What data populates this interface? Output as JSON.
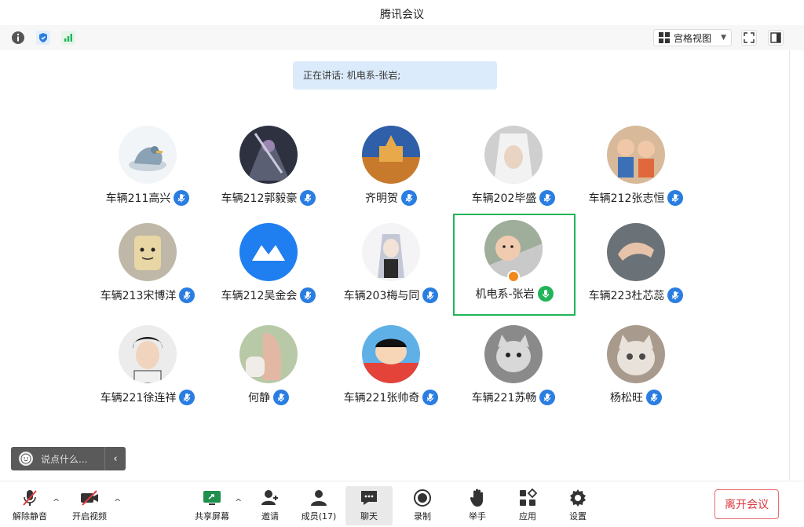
{
  "window": {
    "title": "腾讯会议"
  },
  "topbar": {
    "view_label": "宫格视图"
  },
  "speaking": {
    "text": "正在讲话: 机电系-张岩;"
  },
  "participants": [
    {
      "name": "车辆211高兴"
    },
    {
      "name": "车辆212郭毅豪"
    },
    {
      "name": "齐明贺"
    },
    {
      "name": "车辆202毕盛"
    },
    {
      "name": "车辆212张志恒"
    },
    {
      "name": "车辆213宋博洋"
    },
    {
      "name": "车辆212吴金会"
    },
    {
      "name": "车辆203梅与同"
    },
    {
      "name": "机电系-张岩"
    },
    {
      "name": "车辆223杜芯蕊"
    },
    {
      "name": "车辆221徐连祥"
    },
    {
      "name": "何静"
    },
    {
      "name": "车辆221张帅奇"
    },
    {
      "name": "车辆221苏畅"
    },
    {
      "name": "杨松旺"
    }
  ],
  "chat": {
    "placeholder": "说点什么..."
  },
  "toolbar": {
    "unmute": "解除静音",
    "video": "开启视频",
    "share": "共享屏幕",
    "invite": "邀请",
    "members": "成员(17)",
    "chat": "聊天",
    "record": "录制",
    "raise_hand": "举手",
    "apps": "应用",
    "settings": "设置",
    "leave": "离开会议"
  },
  "colors": {
    "accent": "#2a7de1",
    "speaking_bg": "#dcebfb",
    "active_border": "#22b45a",
    "leave": "#d9363e"
  }
}
